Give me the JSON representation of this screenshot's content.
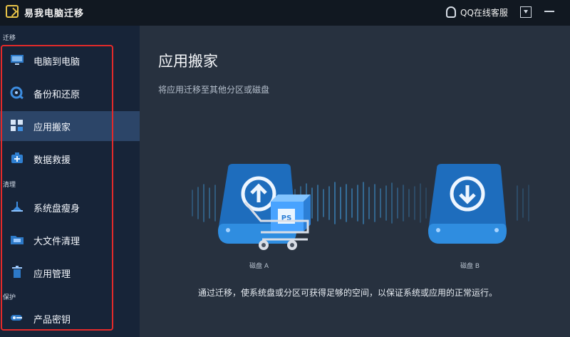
{
  "app": {
    "title": "易我电脑迁移",
    "qq_support": "QQ在线客服"
  },
  "sidebar": {
    "sections": {
      "migrate": "迁移",
      "clean": "清理",
      "protect": "保护"
    },
    "items": [
      {
        "label": "电脑到电脑",
        "icon": "monitor-icon",
        "active": false
      },
      {
        "label": "备份和还原",
        "icon": "backup-restore-icon",
        "active": false
      },
      {
        "label": "应用搬家",
        "icon": "app-move-icon",
        "active": true
      },
      {
        "label": "数据救援",
        "icon": "data-rescue-icon",
        "active": false
      },
      {
        "label": "系统盘瘦身",
        "icon": "system-cleanup-icon",
        "active": false
      },
      {
        "label": "大文件清理",
        "icon": "folder-cleanup-icon",
        "active": false
      },
      {
        "label": "应用管理",
        "icon": "trash-icon",
        "active": false
      },
      {
        "label": "产品密钥",
        "icon": "key-icon",
        "active": false
      }
    ]
  },
  "main": {
    "title": "应用搬家",
    "subtitle": "将应用迁移至其他分区或磁盘",
    "disk_a": "磁盘 A",
    "disk_b": "磁盘 B",
    "app_badge": "PS",
    "description": "通过迁移，使系统盘或分区可获得足够的空间，以保证系统或应用的正常运行。"
  },
  "colors": {
    "titlebar": "#111821",
    "sidebar": "#172438",
    "active_item": "#2c4568",
    "content": "#27313f",
    "accent_blue": "#1f78c8",
    "highlight_frame": "#e32a2a"
  }
}
